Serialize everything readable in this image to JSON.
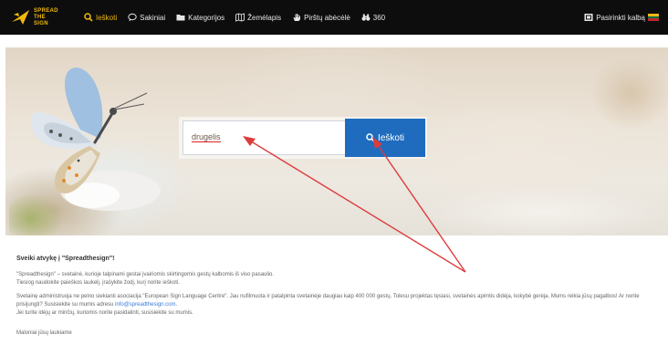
{
  "logo": {
    "line1": "SPREAD",
    "line2": "THE",
    "line3": "SIGN"
  },
  "nav": {
    "items": [
      {
        "label": "Ieškoti",
        "icon": "search-icon",
        "active": true
      },
      {
        "label": "Sakiniai",
        "icon": "speech-bubble-icon",
        "active": false
      },
      {
        "label": "Kategorijos",
        "icon": "folder-icon",
        "active": false
      },
      {
        "label": "Žemėlapis",
        "icon": "map-icon",
        "active": false
      },
      {
        "label": "Pirštų abėcėlė",
        "icon": "hand-icon",
        "active": false
      },
      {
        "label": "360",
        "icon": "binoculars-icon",
        "active": false
      }
    ],
    "language": {
      "label": "Pasirinkti kalbą",
      "icon": "globe-icon",
      "flag_colors": [
        "#fdb913",
        "#006a44",
        "#c1272d"
      ]
    }
  },
  "search": {
    "value": "drugelis",
    "button_label": "Ieškoti"
  },
  "colors": {
    "accent": "#f2b90c",
    "button": "#1f6cbf",
    "annotation": "#dd3c3c"
  },
  "welcome": {
    "title": "Sveiki atvykę į \"Spreadthesign\"!",
    "p1": "\"Spreadthesign\" – svetainė, kurioje talpinami gestai įvairiomis skirtingomis gestų kalbomis iš viso pasaulio.",
    "p2": "Tiesiog naudokite paieškos laukelį, įrašykite žodį, kurį norite ieškoti.",
    "p3": "Svetainę administruoja ne pelno siekianti asociacija \"European Sign Language Centre\". Jau nufilmuota ir patalpinta svetainėje daugiau kaip 400 000 gestų. Tolesu projektas tęsiasi, svetainės apimtis didėja, kokybė gerėja. Mums reikia jūsų pagalbos! Ar norite prisijungti? Susisiekite su mumis adresu ",
    "email": "info@spreadthesign.com",
    "p4": "Jei turite idėjų ar minčių, kuriomis norite pasidalinti, susisiekite su mumis.",
    "p5": "Maloniai jūsų laukiame"
  }
}
